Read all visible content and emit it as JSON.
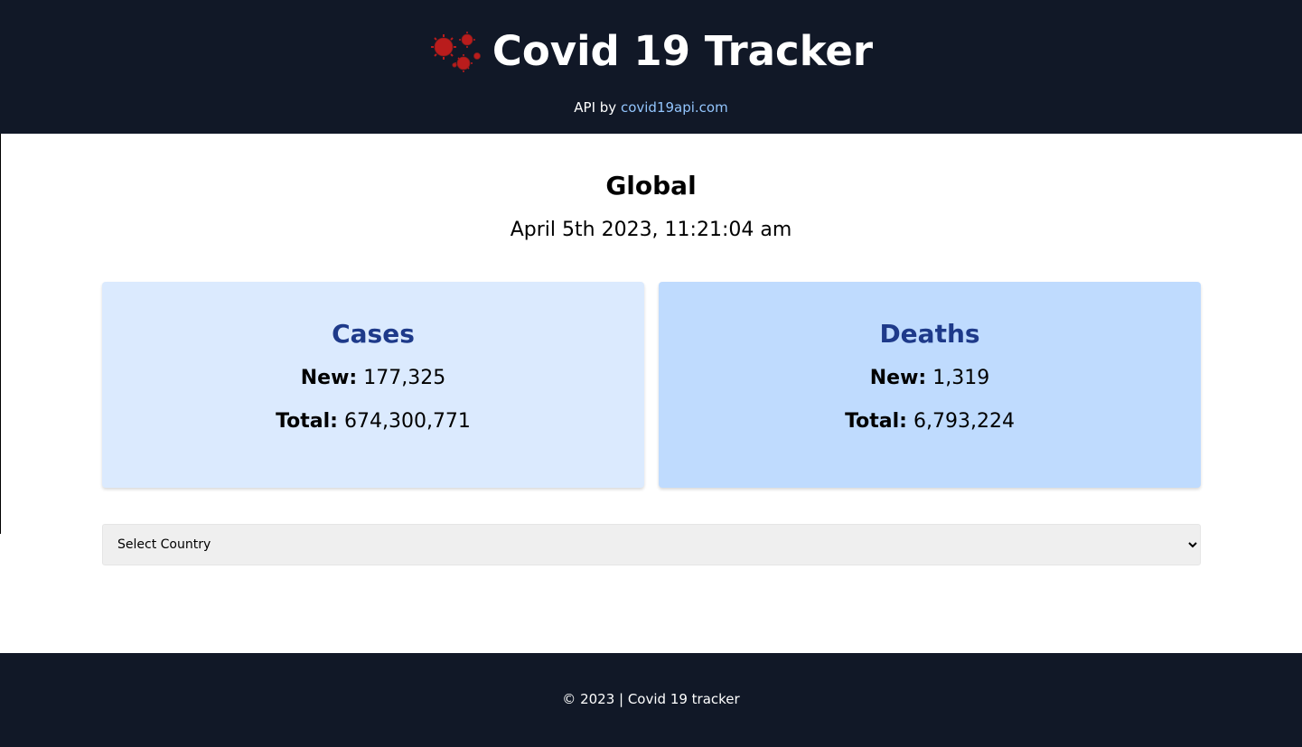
{
  "header": {
    "title": "Covid 19 Tracker",
    "logo_icon": "virus-icon",
    "api_prefix": "API by",
    "api_link_text": "covid19api.com",
    "background": "#111827",
    "link_color": "#93c5fd"
  },
  "main": {
    "region": "Global",
    "timestamp": "April 5th 2023, 11:21:04 am",
    "cards": [
      {
        "title": "Cases",
        "new_label": "New:",
        "new_value": "177,325",
        "total_label": "Total:",
        "total_value": "674,300,771",
        "background": "#dbeafe"
      },
      {
        "title": "Deaths",
        "new_label": "New:",
        "new_value": "1,319",
        "total_label": "Total:",
        "total_value": "6,793,224",
        "background": "#bfdbfe"
      }
    ],
    "title_color": "#1e3a8a",
    "country_select": {
      "selected": "Select Country"
    }
  },
  "footer": {
    "text": "© 2023 | Covid 19 tracker",
    "background": "#111827"
  }
}
